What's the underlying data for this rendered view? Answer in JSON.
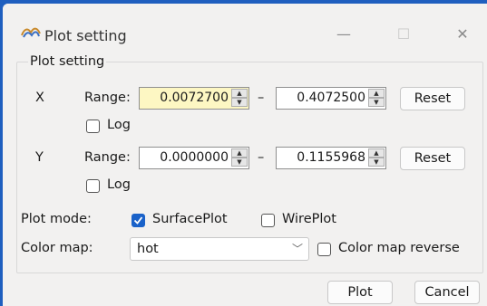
{
  "window": {
    "title": "Plot setting",
    "minimize": "—",
    "maximize": "☐",
    "close": "✕"
  },
  "group": {
    "label": "Plot setting"
  },
  "x_axis": {
    "label": "X",
    "range_label": "Range:",
    "min": "0.0072700",
    "max": "0.4072500",
    "dash": "–",
    "reset_label": "Reset",
    "log_label": "Log",
    "log_checked": false
  },
  "y_axis": {
    "label": "Y",
    "range_label": "Range:",
    "min": "0.0000000",
    "max": "0.1155968",
    "dash": "–",
    "reset_label": "Reset",
    "log_label": "Log",
    "log_checked": false
  },
  "plot_mode": {
    "label": "Plot mode:",
    "surface_label": "SurfacePlot",
    "surface_checked": true,
    "wire_label": "WirePlot",
    "wire_checked": false
  },
  "color_map": {
    "label": "Color map:",
    "value": "hot",
    "reverse_label": "Color map reverse",
    "reverse_checked": false
  },
  "footer": {
    "plot_label": "Plot",
    "cancel_label": "Cancel"
  },
  "colors": {
    "accent": "#1a62c9",
    "highlight_field": "#fdf7c3",
    "frame": "#1f5fbf"
  }
}
